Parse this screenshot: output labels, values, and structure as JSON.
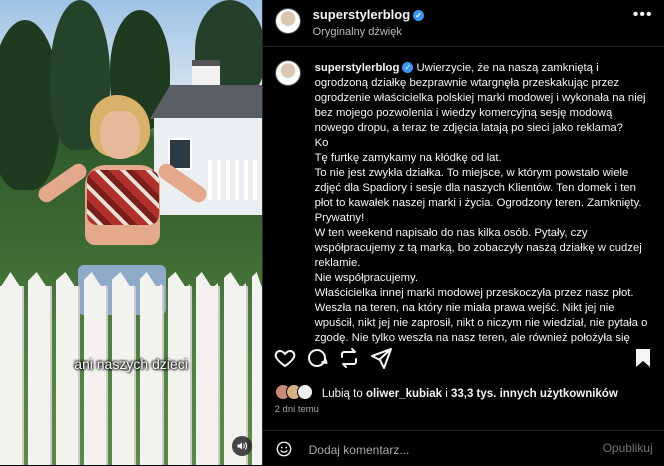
{
  "video": {
    "caption": "ani naszych dzieci"
  },
  "header": {
    "username": "superstylerblog",
    "audio": "Oryginalny dźwięk"
  },
  "comment": {
    "username": "superstylerblog",
    "lines": [
      "Uwierzycie, że na naszą zamkniętą i ogrodzoną działkę bezprawnie wtargnęła przeskakując przez ogrodzenie właścicielka polskiej marki modowej i wykonała na niej bez mojego pozwolenia i wiedzy komercyjną sesję modową nowego dropu, a teraz te zdjęcia latają po sieci jako reklama?",
      "Ko",
      "Tę furtkę zamykamy na kłódkę od lat.",
      "To nie jest zwykła działka. To miejsce, w którym powstało wiele zdjęć dla Spadiory i sesje dla naszych Klientów. Ten domek i ten płot to kawałek naszej marki i życia. Ogrodzony teren. Zamknięty. Prywatny!",
      "W ten weekend napisało do nas kilka osób. Pytały, czy współpracujemy z tą marką, bo zobaczyły naszą działkę w cudzej reklamie.",
      "Nie współpracujemy.",
      "Właścicielka innej marki modowej przeskoczyła przez nasz płot. Weszła na teren, na który nie miała prawa wejść. Nikt jej nie wpuścił, nikt jej nie zaprosił, nikt o niczym nie wiedział, nie pytała o zgodę. Nie tylko weszła na nasz teren, ale również położyła się"
    ]
  },
  "likes": {
    "prefix": "Lubią to",
    "user": "oliwer_kubiak",
    "middle": "i",
    "count": "33,3 tys. innych użytkowników"
  },
  "date": "2 dni temu",
  "add_comment": {
    "placeholder": "Dodaj komentarz...",
    "post_label": "Opublikuj"
  },
  "colors": {
    "verified": "#3897f0",
    "background": "#000000",
    "text": "#f5f5f5",
    "muted": "#a8a8a8"
  }
}
